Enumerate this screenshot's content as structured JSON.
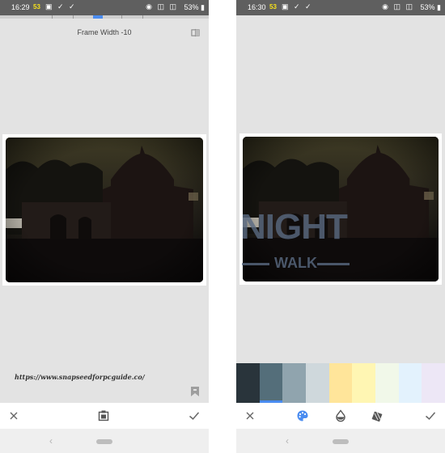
{
  "left_screen": {
    "status": {
      "time": "16:29",
      "badge": "53",
      "battery": "53%"
    },
    "header": {
      "label": "Frame Width -10"
    },
    "footer_url": "https://www.snapseedforpcguide.co/"
  },
  "right_screen": {
    "status": {
      "time": "16:30",
      "badge": "53",
      "battery": "53%"
    },
    "watermark": {
      "line1": "NIGHT",
      "line2": "WALK"
    },
    "swatches": [
      "#29343b",
      "#546e7a",
      "#90a4ae",
      "#cfd8dc",
      "#ffe59a",
      "#fff6b3",
      "#f1f8e9",
      "#e3f2fd",
      "#ede7f6"
    ],
    "selected_swatch_index": 1
  },
  "colors": {
    "accent": "#4a8cf0",
    "statusbar": "#5f5f5f",
    "badge": "#f7e21a"
  }
}
